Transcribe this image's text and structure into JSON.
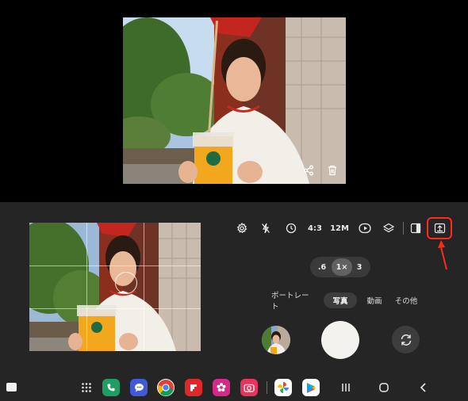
{
  "preview": {
    "actions": [
      {
        "name": "share-icon"
      },
      {
        "name": "trash-icon"
      }
    ]
  },
  "toolbar": {
    "settings_icon": "gear-icon",
    "flash_icon": "flash-off-icon",
    "timer_icon": "timer-icon",
    "aspect_ratio": "4:3",
    "resolution": "12M",
    "motion_icon": "motion-photo-icon",
    "filters_icon": "layers-icon",
    "side_panel_icon": "side-panel-icon",
    "highlighted_icon": "upload-screen-icon",
    "highlight_color": "#ff2a1a"
  },
  "zoom": {
    "options": [
      ".6",
      "1×",
      "3"
    ],
    "selected": "1×"
  },
  "modes": {
    "portrait": "ポートレート",
    "photo": "写真",
    "video": "動画",
    "more": "その他",
    "selected": "写真"
  },
  "taskbar": {
    "apps": [
      "phone-icon",
      "messages-icon",
      "chrome-icon",
      "flipboard-icon",
      "blossom-app-icon",
      "camera-app-icon",
      "photos-icon",
      "play-store-icon"
    ],
    "nav": [
      "recents-icon",
      "home-icon",
      "back-icon"
    ]
  }
}
